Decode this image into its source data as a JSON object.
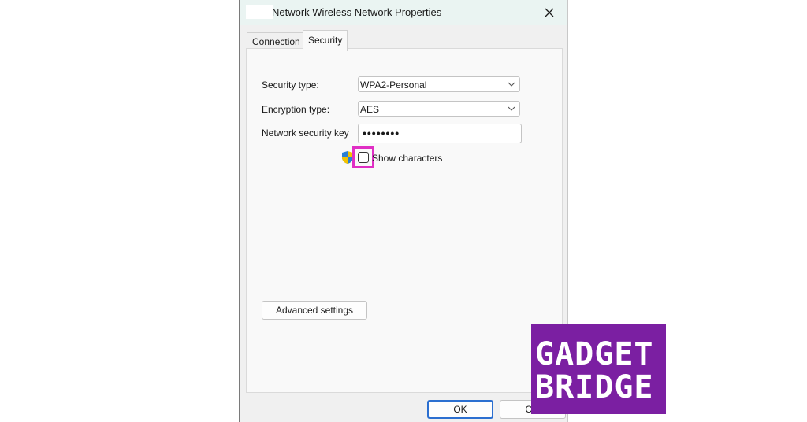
{
  "window": {
    "title": "Network Wireless Network Properties",
    "close_glyph": "✕"
  },
  "tabs": [
    {
      "label": "Connection",
      "selected": false
    },
    {
      "label": "Security",
      "selected": true
    }
  ],
  "security": {
    "security_type_label": "Security type:",
    "security_type_value": "WPA2-Personal",
    "encryption_type_label": "Encryption type:",
    "encryption_type_value": "AES",
    "network_key_label": "Network security key",
    "network_key_value": "••••••••",
    "show_characters_label": "Show characters",
    "show_characters_checked": false,
    "advanced_button": "Advanced settings"
  },
  "footer": {
    "ok_label": "OK",
    "cancel_label": "Car"
  },
  "watermark": {
    "line1": "GADGET",
    "line2": "BRIDGE"
  },
  "colors": {
    "highlight": "#e02fc4",
    "logo_bg": "#7b1fa2",
    "ok_border": "#2b6fd0"
  },
  "icons": [
    "close-icon",
    "chevron-down-icon",
    "uac-shield-icon",
    "checkbox-icon"
  ]
}
